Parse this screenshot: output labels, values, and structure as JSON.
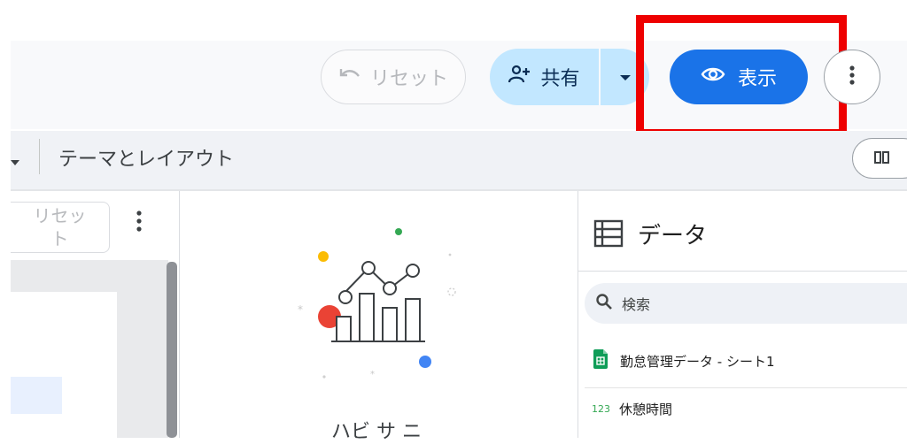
{
  "header": {
    "reset_label": "リセット",
    "share_label": "共有",
    "view_label": "表示"
  },
  "toolbar2": {
    "theme_layout_label": "テーマとレイアウト"
  },
  "left_panel": {
    "reset_label": "リセッ\nト"
  },
  "middle": {
    "partial_text": "ハビ サ ニ"
  },
  "data_panel": {
    "title": "データ",
    "search_placeholder": "検索",
    "source_name": "勤怠管理データ - シート1",
    "field_type": "123",
    "field_name": "休憩時間"
  },
  "colors": {
    "primary": "#1a73e8",
    "share_bg": "#c2e7ff",
    "highlight": "#ee0000",
    "sheets_green": "#0f9d58"
  }
}
